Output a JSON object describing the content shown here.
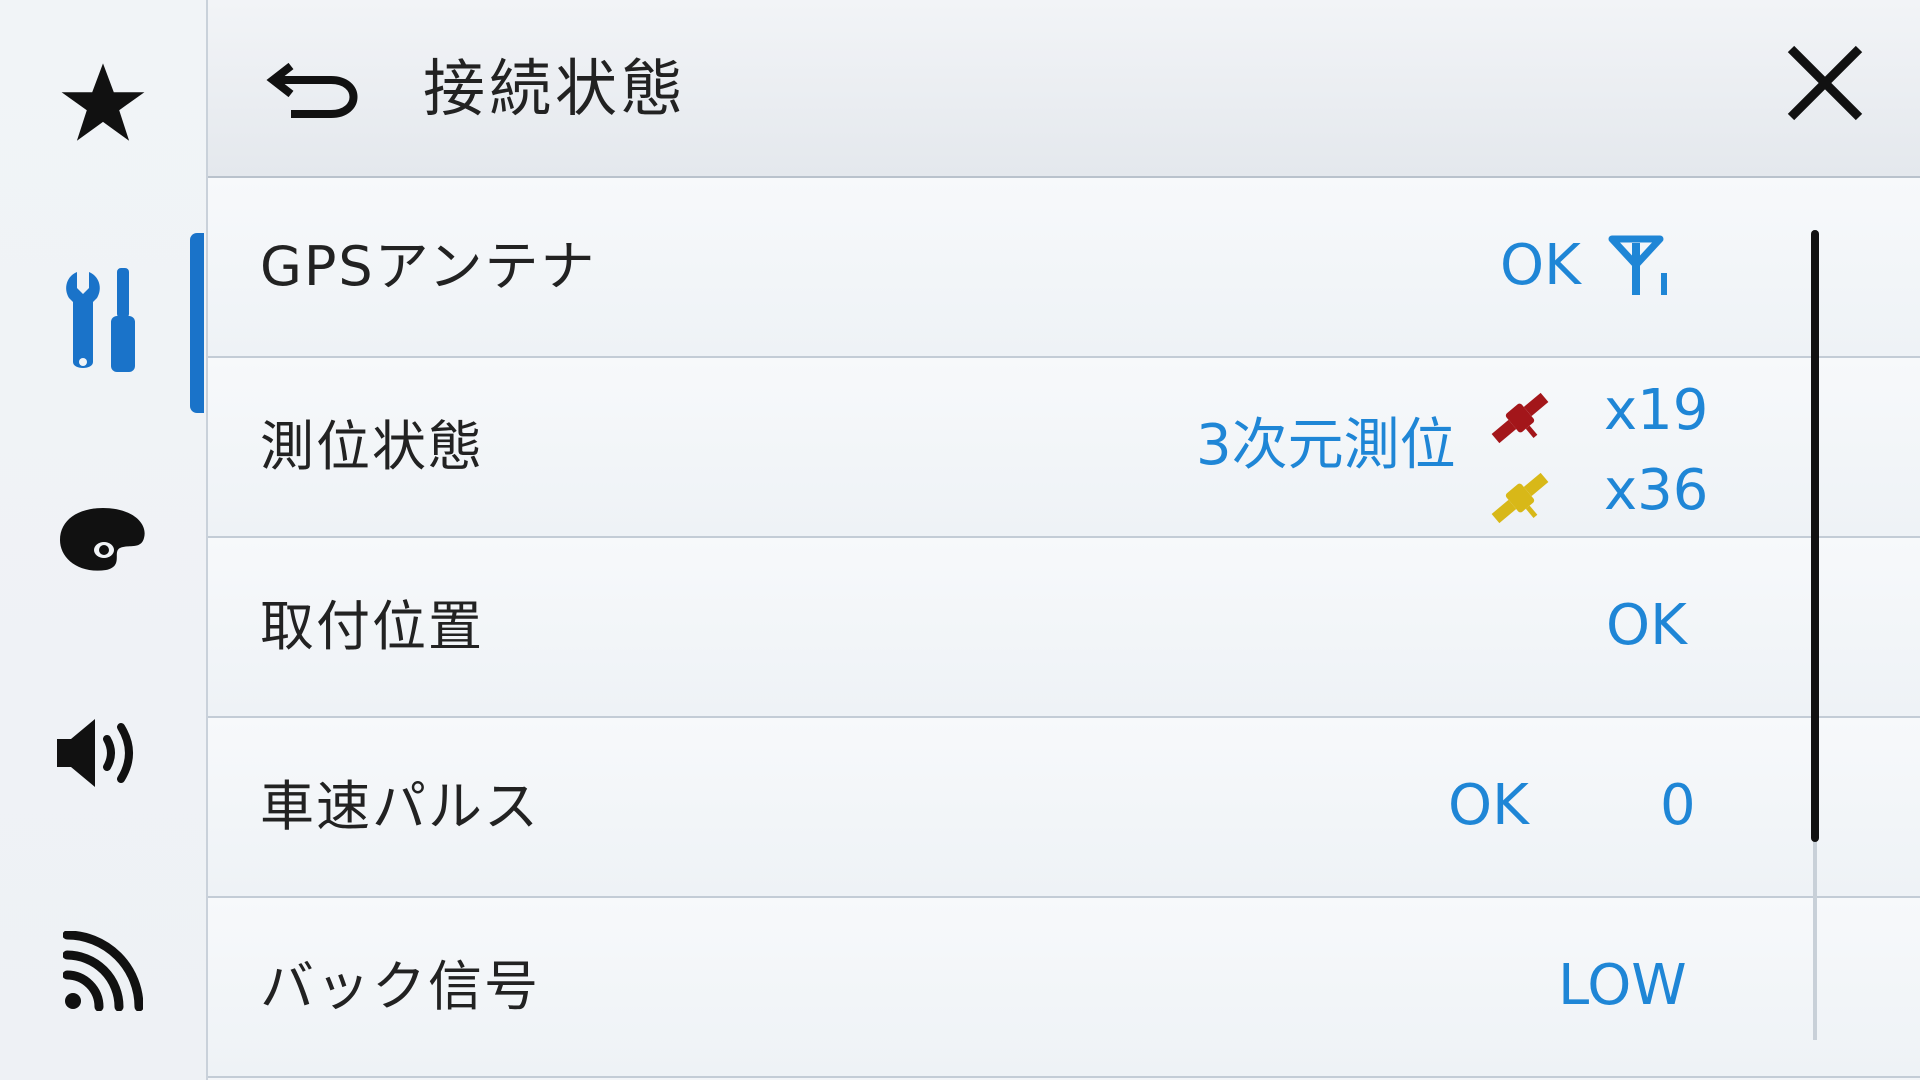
{
  "header": {
    "title": "接続状態",
    "back_icon": "back-arrow-icon",
    "close_icon": "close-icon"
  },
  "sidebar": {
    "items": [
      {
        "icon": "star-icon",
        "active": false
      },
      {
        "icon": "tools-icon",
        "active": true
      },
      {
        "icon": "palette-icon",
        "active": false
      },
      {
        "icon": "speaker-icon",
        "active": false
      },
      {
        "icon": "wireless-icon",
        "active": false
      }
    ]
  },
  "rows": [
    {
      "label": "GPSアンテナ",
      "status": "OK",
      "icon": "antenna-icon"
    },
    {
      "label": "測位状態",
      "status": "3次元測位",
      "satellites": [
        {
          "icon": "satellite-red-icon",
          "count": "x19",
          "color": "#a3161a"
        },
        {
          "icon": "satellite-yellow-icon",
          "count": "x36",
          "color": "#d8b818"
        }
      ]
    },
    {
      "label": "取付位置",
      "status": "OK"
    },
    {
      "label": "車速パルス",
      "status": "OK",
      "value": "0"
    },
    {
      "label": "バック信号",
      "status": "LOW"
    }
  ],
  "colors": {
    "accent": "#1a73c9",
    "value_text": "#1f86d6",
    "label_text": "#222222"
  }
}
